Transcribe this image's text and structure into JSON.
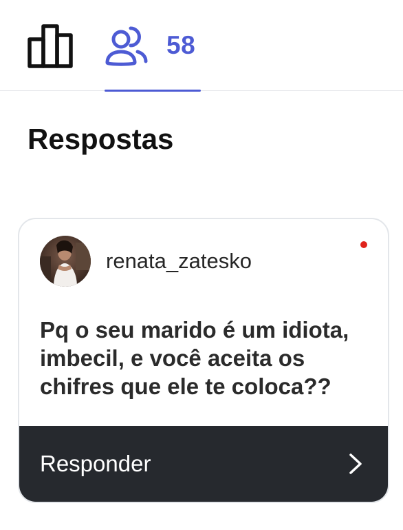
{
  "tabs": {
    "insights": {
      "icon": "bar-chart-icon"
    },
    "viewers": {
      "icon": "people-icon",
      "count": "58",
      "accent": "#4d5bd4"
    }
  },
  "section": {
    "title": "Respostas"
  },
  "response": {
    "username": "renata_zatesko",
    "avatar": "profile-photo",
    "unread_color": "#e0231b",
    "question": "Pq o seu marido é um idiota, imbecil, e você aceita os chifres que ele te coloca??",
    "reply_label": "Responder",
    "reply_icon": "chevron-right-icon"
  }
}
